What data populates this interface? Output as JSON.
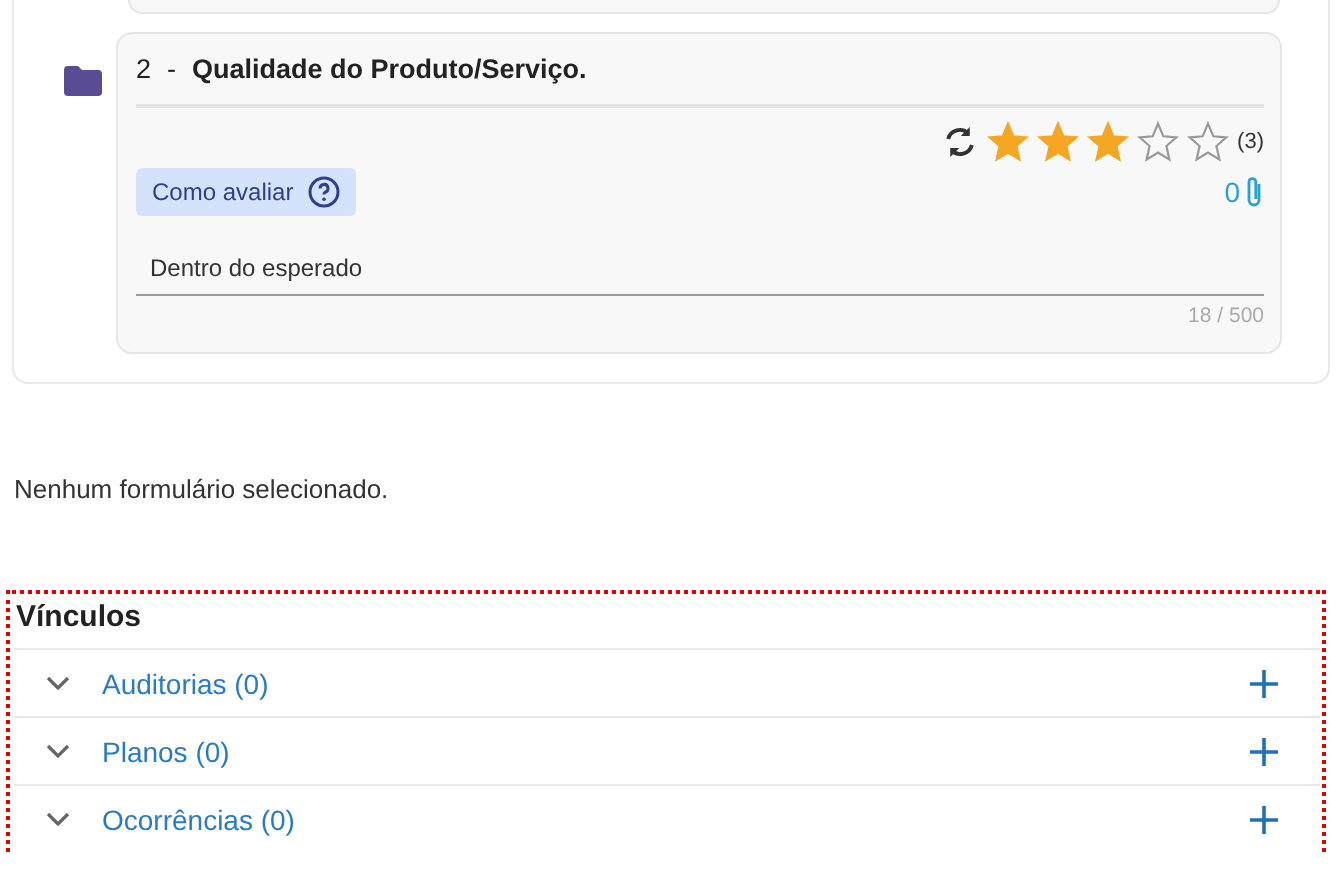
{
  "question": {
    "number": "2",
    "separator": "-",
    "title": "Qualidade do Produto/Serviço.",
    "stars": 3,
    "star_count": "(3)",
    "help_button": "Como avaliar",
    "attachments": "0",
    "comment": "Dentro do esperado",
    "counter": "18 / 500"
  },
  "message": "Nenhum formulário selecionado.",
  "links": {
    "title": "Vínculos",
    "items": [
      {
        "label": "Auditorias (0)",
        "expanded": false
      },
      {
        "label": "Planos (0)",
        "expanded": false
      },
      {
        "label": "Ocorrências (0)",
        "expanded": false
      }
    ]
  }
}
